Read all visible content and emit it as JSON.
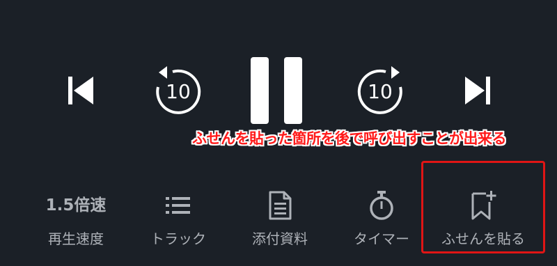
{
  "transport": {
    "previous_icon": "skip-previous-icon",
    "rewind_icon": "rewind-10-icon",
    "rewind_seconds": "10",
    "pause_icon": "pause-icon",
    "forward_icon": "forward-10-icon",
    "forward_seconds": "10",
    "next_icon": "skip-next-icon"
  },
  "annotation": {
    "text": "ふせんを貼った箇所を後で呼び出すことが出来る",
    "color": "#ff1a1a"
  },
  "toolbar": {
    "speed": {
      "value": "1.5倍速",
      "label": "再生速度"
    },
    "track": {
      "icon": "list-icon",
      "label": "トラック"
    },
    "attachment": {
      "icon": "document-icon",
      "label": "添付資料"
    },
    "timer": {
      "icon": "stopwatch-icon",
      "label": "タイマー"
    },
    "bookmark": {
      "icon": "bookmark-add-icon",
      "label": "ふせんを貼る"
    }
  },
  "colors": {
    "background": "#1b2027",
    "control": "#ffffff",
    "toolbar_text": "#aeb2b8",
    "highlight": "#e01515"
  }
}
